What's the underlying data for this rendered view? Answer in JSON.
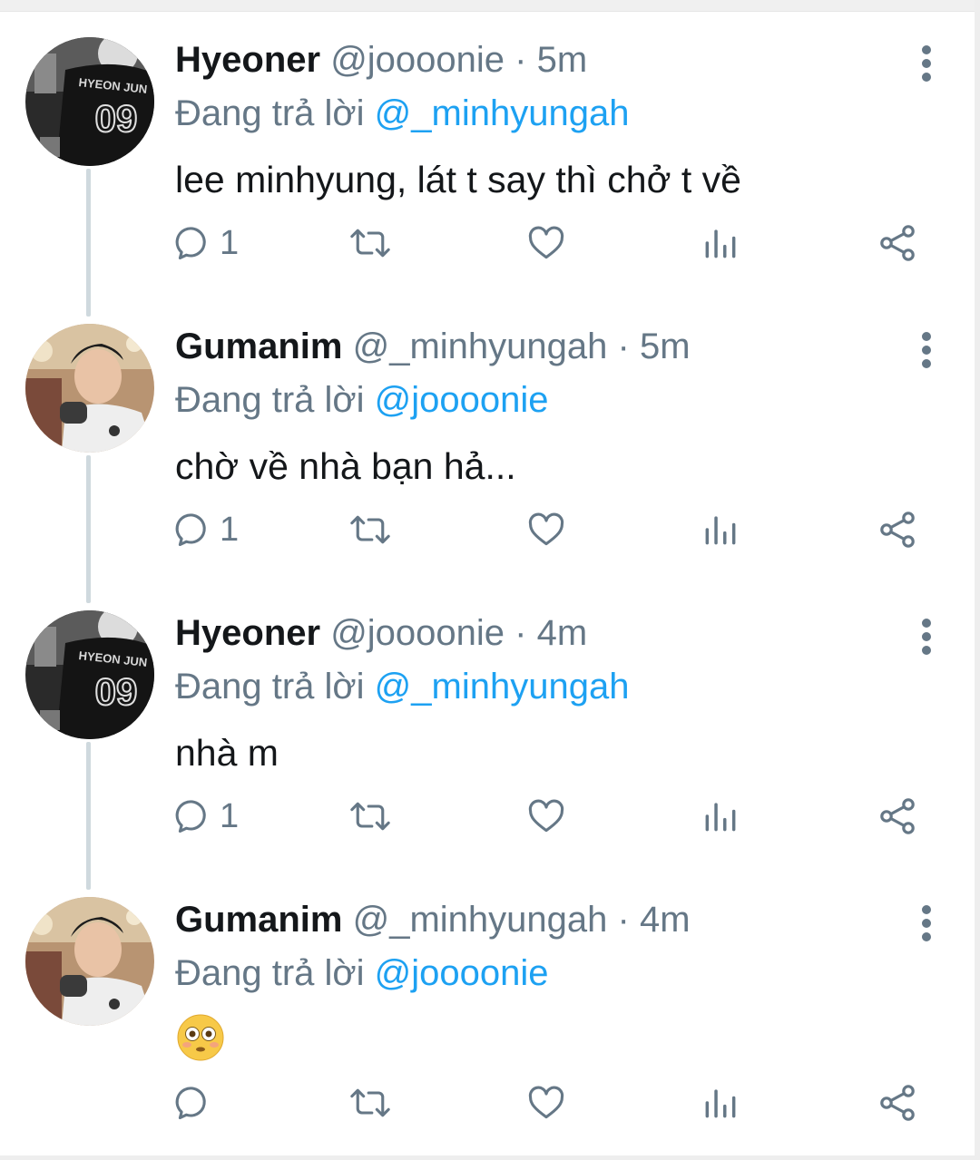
{
  "thread": {
    "reply_prefix": "Đang trả lời",
    "tweets": [
      {
        "display_name": "Hyeoner",
        "handle": "@joooonie",
        "separator": "·",
        "time": "5m",
        "reply_to": "@_minhyungah",
        "text": "lee minhyung, lát t say thì chở t về",
        "reply_count": "1",
        "avatar": "hyeoner-avatar",
        "avatar_jersey_text": "HYEON JUN",
        "avatar_jersey_number": "09"
      },
      {
        "display_name": "Gumanim",
        "handle": "@_minhyungah",
        "separator": "·",
        "time": "5m",
        "reply_to": "@joooonie",
        "text": "chờ về nhà bạn hả...",
        "reply_count": "1",
        "avatar": "gumanim-avatar"
      },
      {
        "display_name": "Hyeoner",
        "handle": "@joooonie",
        "separator": "·",
        "time": "4m",
        "reply_to": "@_minhyungah",
        "text": "nhà m",
        "reply_count": "1",
        "avatar": "hyeoner-avatar",
        "avatar_jersey_text": "HYEON JUN",
        "avatar_jersey_number": "09"
      },
      {
        "display_name": "Gumanim",
        "handle": "@_minhyungah",
        "separator": "·",
        "time": "4m",
        "reply_to": "@joooonie",
        "text": "",
        "emoji": "flushed-face-emoji",
        "reply_count": "",
        "avatar": "gumanim-avatar"
      }
    ]
  },
  "icons": {
    "reply": "reply-icon",
    "retweet": "retweet-icon",
    "like": "heart-icon",
    "stats": "stats-icon",
    "share": "share-icon",
    "more": "more-options-icon"
  },
  "colors": {
    "mention": "#1da1f2",
    "secondary_text": "#657786",
    "primary_text": "#14171a",
    "thread_line": "#cfd9de"
  }
}
